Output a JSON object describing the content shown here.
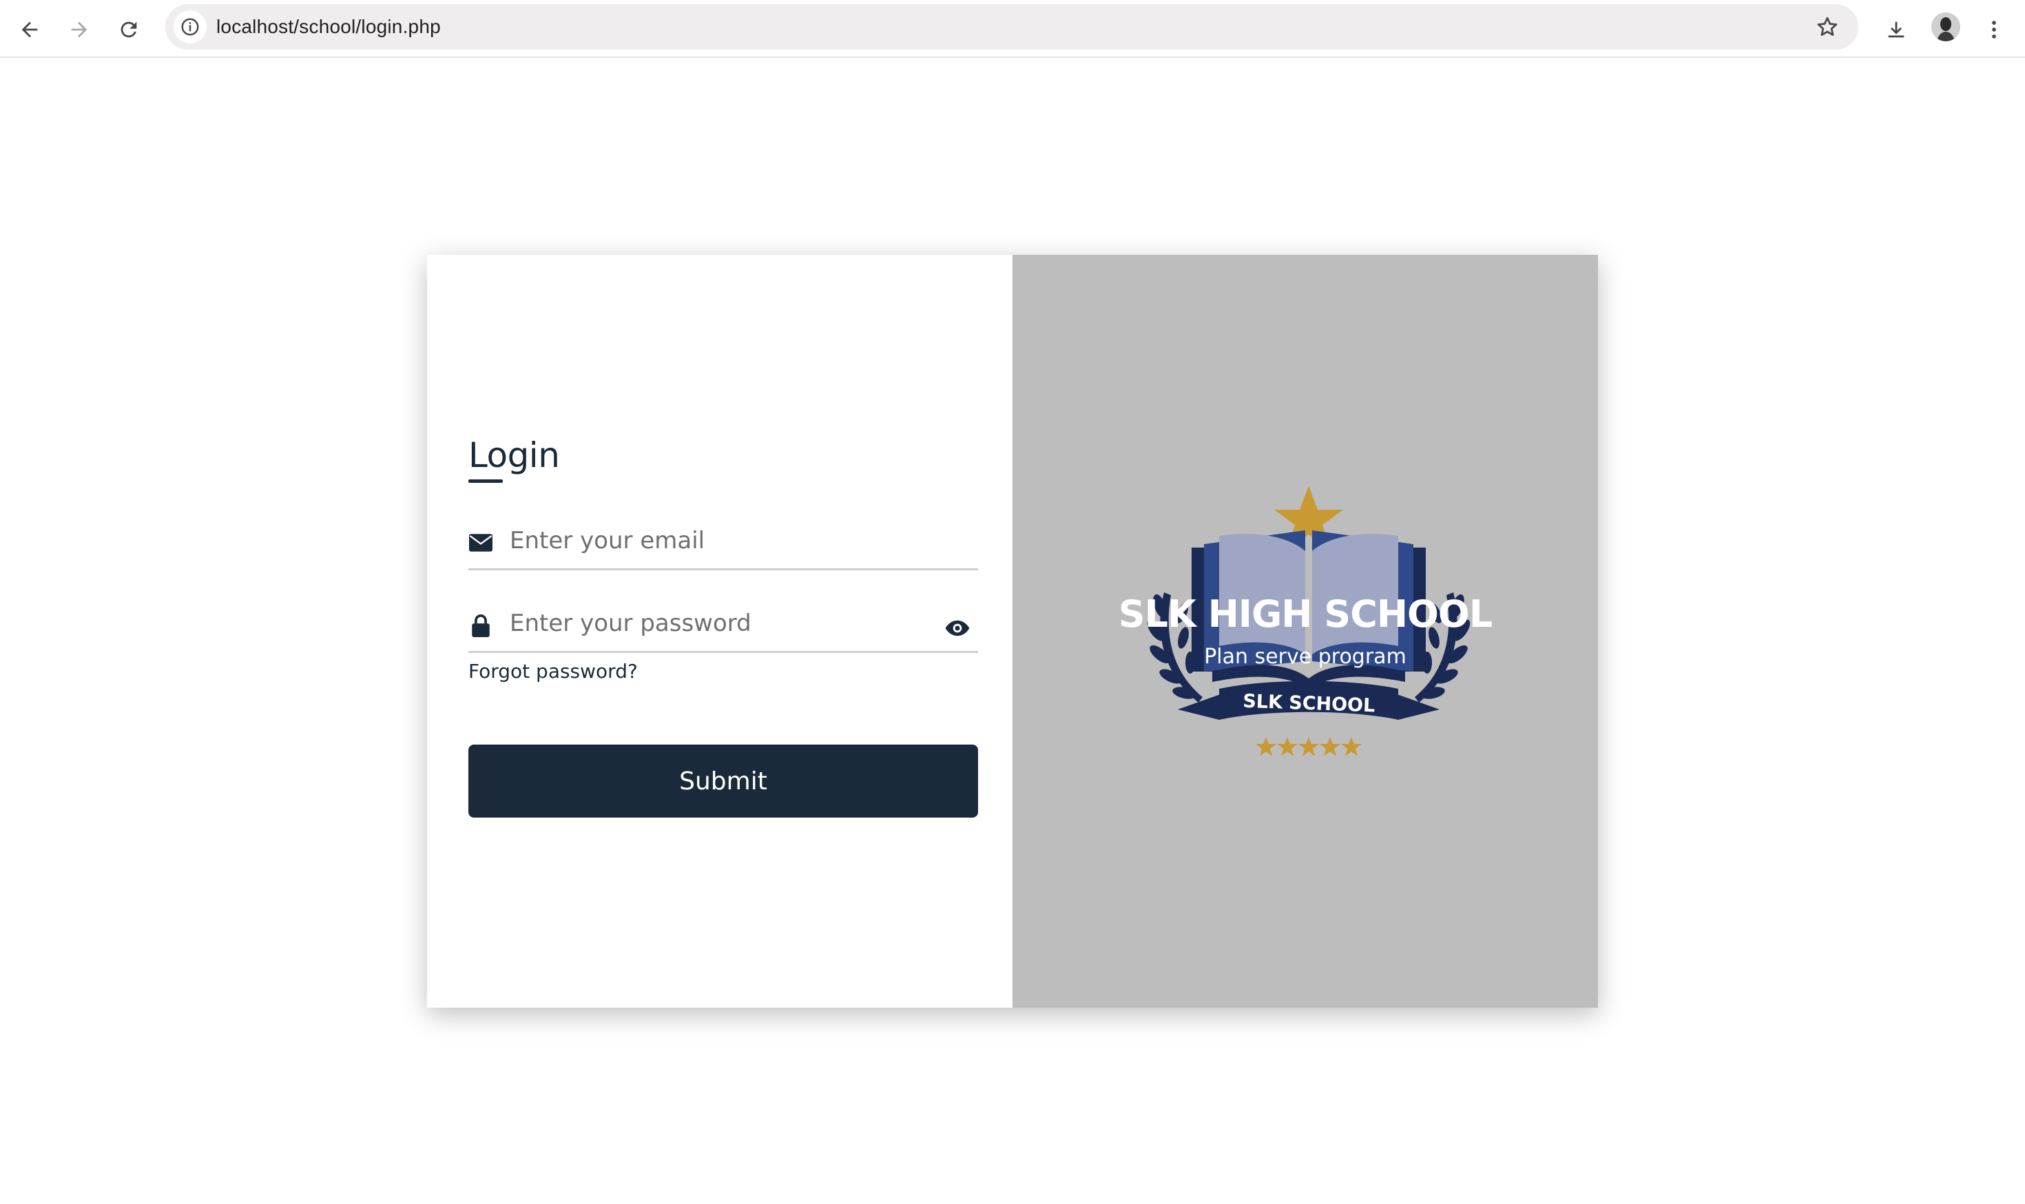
{
  "browser": {
    "url": "localhost/school/login.php"
  },
  "login": {
    "title": "Login",
    "email_placeholder": "Enter your email",
    "password_placeholder": "Enter your password",
    "forgot_label": "Forgot password?",
    "submit_label": "Submit"
  },
  "brand": {
    "name": "SLK HIGH SCHOOL",
    "tagline": "Plan serve program",
    "banner_text": "SLK SCHOOL"
  },
  "colors": {
    "primary": "#1b2a3b",
    "panel_bg": "#bdbdbd",
    "gold": "#c89a34",
    "navy": "#1a2a55"
  }
}
